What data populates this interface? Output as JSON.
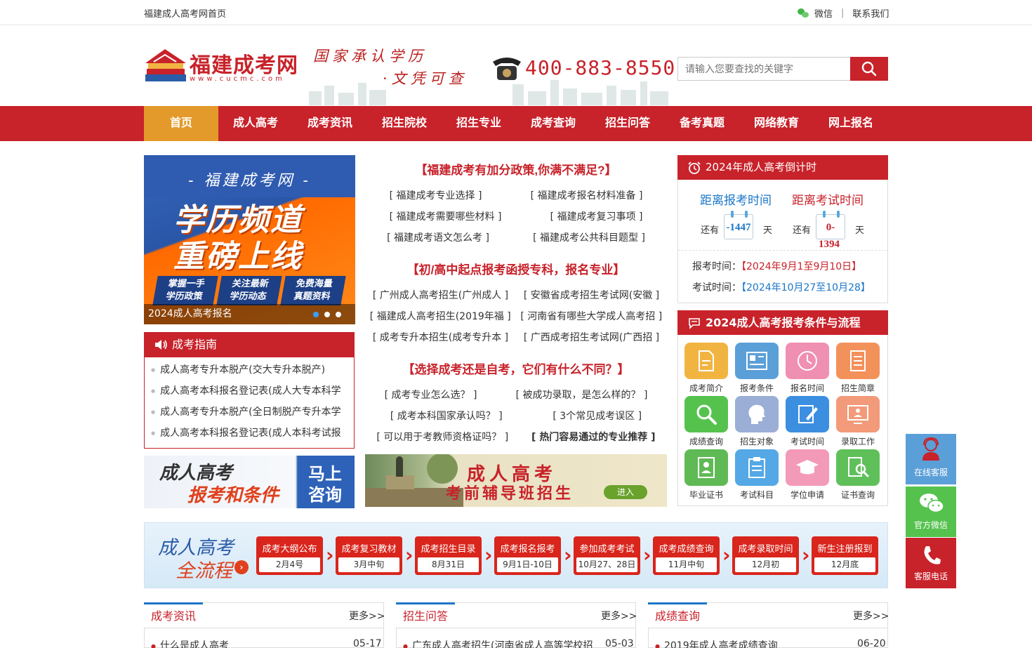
{
  "topbar": {
    "home_link": "福建成人高考网首页",
    "wechat_label": "微信",
    "separator": "|",
    "contact_label": "联系我们"
  },
  "header": {
    "logo_name": "福建成考网",
    "logo_url": "www.cucmc.com",
    "slogan_line1": "国家承认学历",
    "slogan_line2": "·文凭可查",
    "hotline": "400-883-8550",
    "search_placeholder": "请输入您要查找的关键字",
    "search_icon": "search-icon"
  },
  "nav": {
    "items": [
      "首页",
      "成人高考",
      "成考资讯",
      "招生院校",
      "招生专业",
      "成考查询",
      "招生问答",
      "备考真题",
      "网络教育",
      "网上报名"
    ],
    "active_index": 0
  },
  "banner": {
    "kicker": "- 福建成考网 -",
    "headline1": "学历频道",
    "headline2": "重磅上线",
    "tags": [
      {
        "line1": "掌握一手",
        "line2": "学历政策"
      },
      {
        "line1": "关注最新",
        "line2": "学历动态"
      },
      {
        "line1": "免费海量",
        "line2": "真题资料"
      }
    ],
    "caption": "2024成人高考报名",
    "slide_count": 3,
    "active_slide": 0
  },
  "guide": {
    "title": "成考指南",
    "items": [
      "成人高考专升本脱产(交大专升本脱产)",
      "成人高考本科报名登记表(成人大专本科学",
      "成人高考专升本脱产(全日制脱产专升本学",
      "成人高考本科报名登记表(成人本科考试报"
    ]
  },
  "ads": {
    "ad1_line1": "成人高考",
    "ad1_line2": "报考和条件",
    "ad1_btn1": "马上",
    "ad1_btn2": "咨询",
    "ad2_line1": "成人高考",
    "ad2_line2": "考前辅导班招生",
    "ad2_btn": "进入"
  },
  "middle": {
    "sections": [
      {
        "title": "【福建成考有加分政策,你满不满足?】",
        "rows": [
          [
            "福建成考专业选择",
            "福建成考报名材料准备"
          ],
          [
            "福建成考需要哪些材料",
            "福建成考复习事项"
          ],
          [
            "福建成考语文怎么考",
            "福建成考公共科目题型"
          ]
        ]
      },
      {
        "title": "【初/高中起点报考函授专科，报名专业】",
        "rows": [
          [
            "广州成人高考招生(广州成人",
            "安徽省成考招生考试网(安徽"
          ],
          [
            "福建成人高考招生(2019年福",
            "河南省有哪些大学成人高考招"
          ],
          [
            "成考专升本招生(成考专升本",
            "广西成考招生考试网(广西招"
          ]
        ]
      },
      {
        "title": "【选择成考还是自考，它们有什么不同？】",
        "rows": [
          [
            "成考专业怎么选？",
            "被成功录取，是怎么样的？"
          ],
          [
            "成考本科国家承认吗？",
            "3个常见成考误区"
          ],
          [
            "可以用于考教师资格证吗？",
            "热门容易通过的专业推荐"
          ]
        ]
      }
    ]
  },
  "countdown": {
    "title": "2024年成人高考倒计时",
    "reg_label": "距离报考时间",
    "exam_label": "距离考试时间",
    "prefix": "还有",
    "suffix": "天",
    "reg_days": "-1447",
    "exam_days_line1": "0-",
    "exam_days_line2": "1394",
    "reg_time_label": "报考时间：",
    "reg_time_value": "【2024年9月1至9月10日】",
    "exam_time_label": "考试时间：",
    "exam_time_value": "【2024年10月27至10月28】",
    "colors": {
      "reg_label": "#1b76c8",
      "exam_label": "#c8222a"
    }
  },
  "process": {
    "title": "2024成人高考报考条件与流程",
    "tiles": [
      {
        "label": "成考简介",
        "icon": "document-icon",
        "color": "#f2b441"
      },
      {
        "label": "报考条件",
        "icon": "newspaper-icon",
        "color": "#5b9fd8"
      },
      {
        "label": "报名时间",
        "icon": "clock-icon",
        "color": "#ef8fb1"
      },
      {
        "label": "招生简章",
        "icon": "list-document-icon",
        "color": "#f3915b"
      },
      {
        "label": "成绩查询",
        "icon": "magnifier-icon",
        "color": "#55c24e"
      },
      {
        "label": "招生对象",
        "icon": "head-profile-icon",
        "color": "#9aaed6"
      },
      {
        "label": "考试时间",
        "icon": "edit-note-icon",
        "color": "#3c8fe0"
      },
      {
        "label": "录取工作",
        "icon": "monitor-person-icon",
        "color": "#f29a7a"
      },
      {
        "label": "毕业证书",
        "icon": "certificate-icon",
        "color": "#5fba55"
      },
      {
        "label": "考试科目",
        "icon": "clipboard-icon",
        "color": "#54a8e6"
      },
      {
        "label": "学位申请",
        "icon": "graduation-cap-icon",
        "color": "#f39ab9"
      },
      {
        "label": "证书查询",
        "icon": "document-search-icon",
        "color": "#5fc05a"
      }
    ]
  },
  "flow": {
    "title1": "成人高考",
    "title2": "全流程",
    "steps": [
      {
        "title": "成考大纲公布",
        "date": "2月4号"
      },
      {
        "title": "成考复习教材",
        "date": "3月中旬"
      },
      {
        "title": "成考招生目录",
        "date": "8月31日"
      },
      {
        "title": "成考报名报考",
        "date": "9月1日-10日"
      },
      {
        "title": "参加成考考试",
        "date": "10月27、28日"
      },
      {
        "title": "成考成绩查询",
        "date": "11月中旬"
      },
      {
        "title": "成考录取时间",
        "date": "12月初"
      },
      {
        "title": "新生注册报到",
        "date": "12月底"
      }
    ]
  },
  "sections": [
    {
      "title": "成考资讯",
      "more": "更多>>",
      "first_item": "什么是成人高考",
      "first_date": "05-17"
    },
    {
      "title": "招生问答",
      "more": "更多>>",
      "first_item": "广东成人高考招生(河南省成人高等学校招",
      "first_date": "05-03"
    },
    {
      "title": "成绩查询",
      "more": "更多>>",
      "first_item": "2019年成人高考成绩查询",
      "first_date": "06-20"
    }
  ],
  "floating": {
    "service_label": "在线客服",
    "wechat_label": "官方微信",
    "phone_label": "客服电话",
    "colors": {
      "service": "#5b9fd8",
      "wechat": "#55c24e",
      "phone": "#c8222a"
    }
  }
}
